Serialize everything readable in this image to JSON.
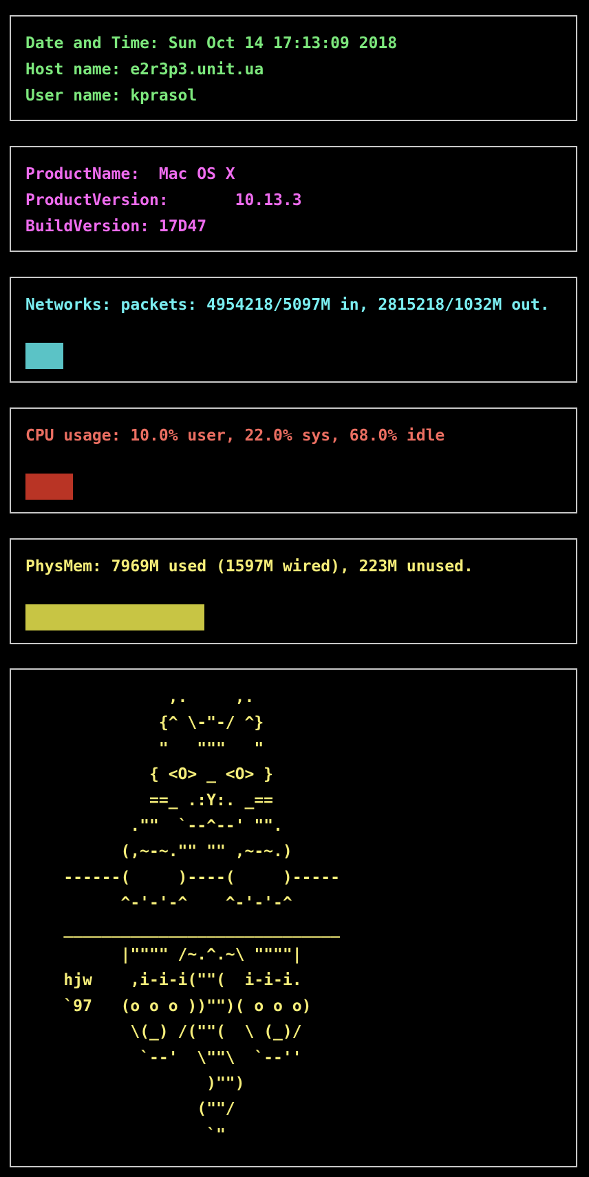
{
  "system_panel": {
    "date_time": "Date and Time: Sun Oct 14 17:13:09 2018",
    "host_name": "Host name: e2r3p3.unit.ua",
    "user_name": "User name: kprasol"
  },
  "os_panel": {
    "product_name": "ProductName:  Mac OS X",
    "product_version": "ProductVersion:       10.13.3",
    "build_version": "BuildVersion: 17D47"
  },
  "network_panel": {
    "text": "Networks: packets: 4954218/5097M in, 2815218/1032M out.",
    "bar_color": "#5bc3c6",
    "bar_fraction": 0.07
  },
  "cpu_panel": {
    "text": "CPU usage: 10.0% user, 22.0% sys, 68.0% idle",
    "bar_color": "#b93425",
    "bar_fraction": 0.088
  },
  "mem_panel": {
    "text": "PhysMem: 7969M used (1597M wired), 223M unused.",
    "bar_color": "#c8c544",
    "bar_fraction": 0.333
  },
  "art_panel": {
    "lines": [
      "               ,.     ,.",
      "              {^ \\-\"-/ ^}",
      "              \"   \"\"\"   \"",
      "             { <O> _ <O> }",
      "             ==_ .:Y:. _==",
      "           .\"\"  `--^--' \"\".",
      "          (,~-~.\"\" \"\" ,~-~.)",
      "    ------(     )----(     )-----",
      "          ^-'-'-^    ^-'-'-^",
      "    _____________________________",
      "          |\"\"\"\" /~.^.~\\ \"\"\"\"|",
      "    hjw    ,i-i-i(\"\"(  i-i-i.",
      "    `97   (o o o ))\"\")( o o o)",
      "           \\(_) /(\"\"(  \\ (_)/",
      "            `--'  \\\"\"\\  `--''",
      "                   )\"\")",
      "                  (\"\"/",
      "                   `\""
    ]
  }
}
